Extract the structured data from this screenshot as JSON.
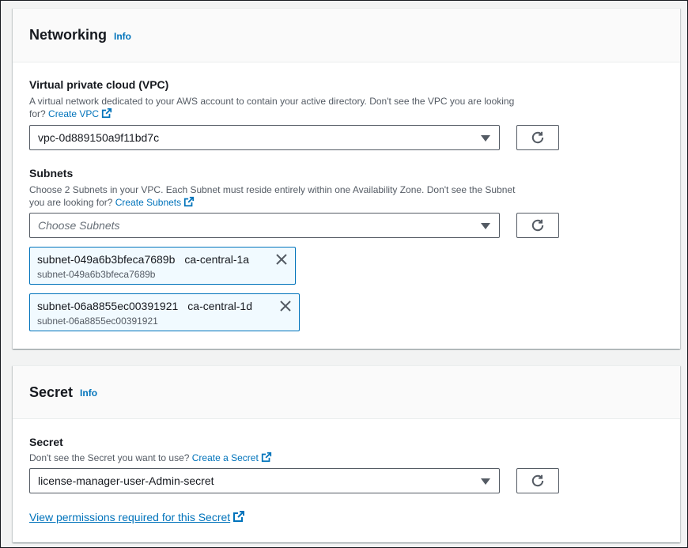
{
  "networking": {
    "title": "Networking",
    "info": "Info",
    "vpc": {
      "label": "Virtual private cloud (VPC)",
      "description": "A virtual network dedicated to your AWS account to contain your active directory. Don't see the VPC you are looking",
      "description2": "for?",
      "create_link": "Create VPC",
      "selected": "vpc-0d889150a9f11bd7c"
    },
    "subnets": {
      "label": "Subnets",
      "description": "Choose 2 Subnets in your VPC. Each Subnet must reside entirely within one Availability Zone. Don't see the Subnet",
      "description2": "you are looking for?",
      "create_link": "Create Subnets",
      "placeholder": "Choose Subnets",
      "tokens": [
        {
          "id": "subnet-049a6b3bfeca7689b",
          "zone": "ca-central-1a",
          "sub": "subnet-049a6b3bfeca7689b"
        },
        {
          "id": "subnet-06a8855ec00391921",
          "zone": "ca-central-1d",
          "sub": "subnet-06a8855ec00391921"
        }
      ]
    }
  },
  "secret_panel": {
    "title": "Secret",
    "info": "Info",
    "secret": {
      "label": "Secret",
      "description": "Don't see the Secret you want to use?",
      "create_link": "Create a Secret",
      "selected": "license-manager-user-Admin-secret"
    },
    "permissions_link": "View permissions required for this Secret"
  },
  "icons": {
    "external": "external-link-icon",
    "refresh": "refresh-icon",
    "caret": "caret-down-icon",
    "close": "close-icon"
  },
  "colors": {
    "link": "#0073bb",
    "token_bg": "#f1faff",
    "border": "#545b64"
  }
}
